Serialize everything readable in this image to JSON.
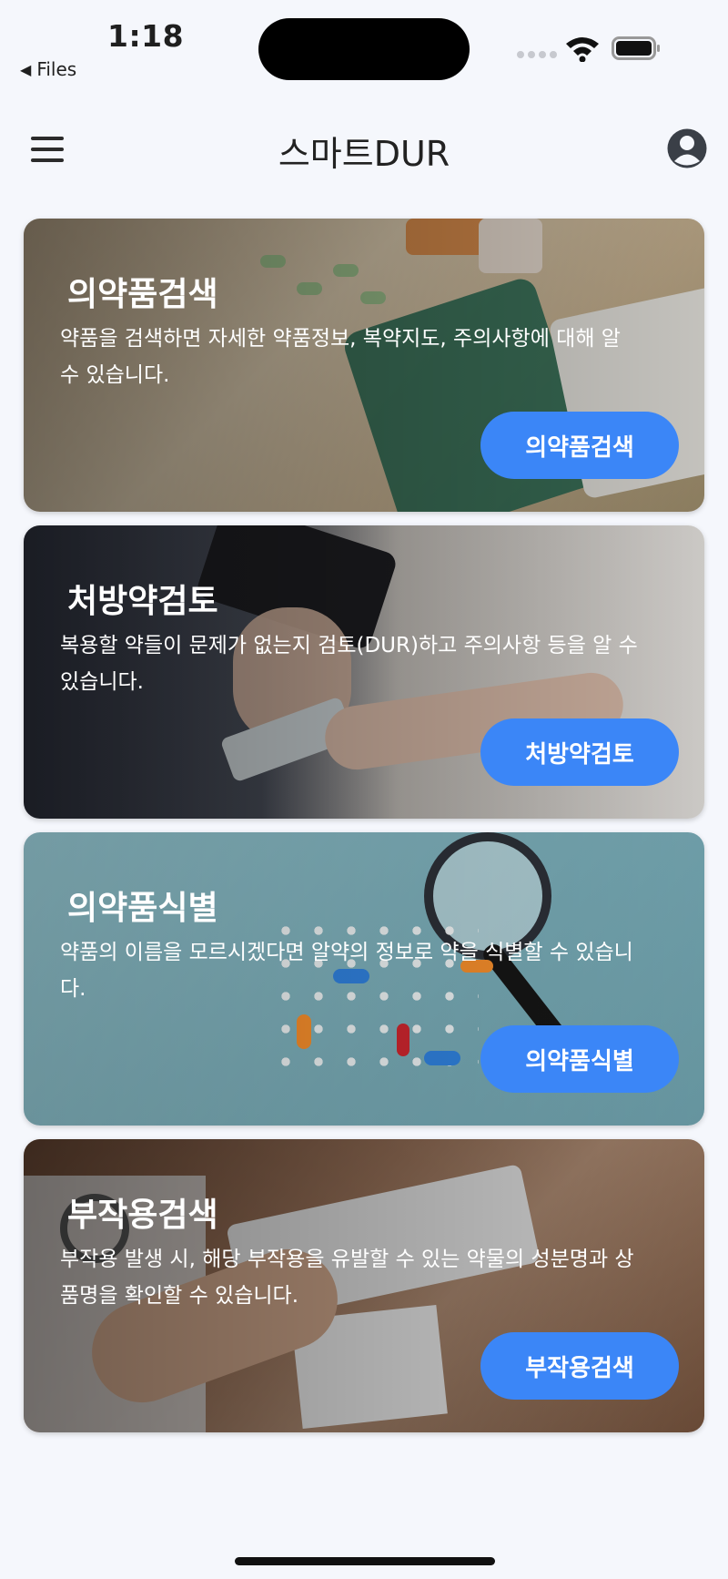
{
  "status_bar": {
    "time": "1:18",
    "back_app": "Files"
  },
  "header": {
    "title": "스마트DUR"
  },
  "cards": [
    {
      "title": "의약품검색",
      "description": "약품을 검색하면 자세한 약품정보, 복약지도, 주의사항에 대해 알 수 있습니다.",
      "button": "의약품검색",
      "bg": "#c9b79a"
    },
    {
      "title": "처방약검토",
      "description": "복용할 약들이 문제가 없는지 검토(DUR)하고 주의사항 등을 알 수 있습니다.",
      "button": "처방약검토",
      "bg": "#6a6f7c"
    },
    {
      "title": "의약품식별",
      "description": "약품의 이름을 모르시겠다면 알약의 정보로 약을 식별할 수 있습니다.",
      "button": "의약품식별",
      "bg": "#7eb2bd"
    },
    {
      "title": "부작용검색",
      "description": "부작용 발생 시, 해당 부작용을 유발할 수 있는 약물의 성분명과 상품명을 확인할 수 있습니다.",
      "button": "부작용검색",
      "bg": "#8a6a55"
    }
  ],
  "colors": {
    "accent": "#3b86f7",
    "background": "#f5f7fc"
  }
}
